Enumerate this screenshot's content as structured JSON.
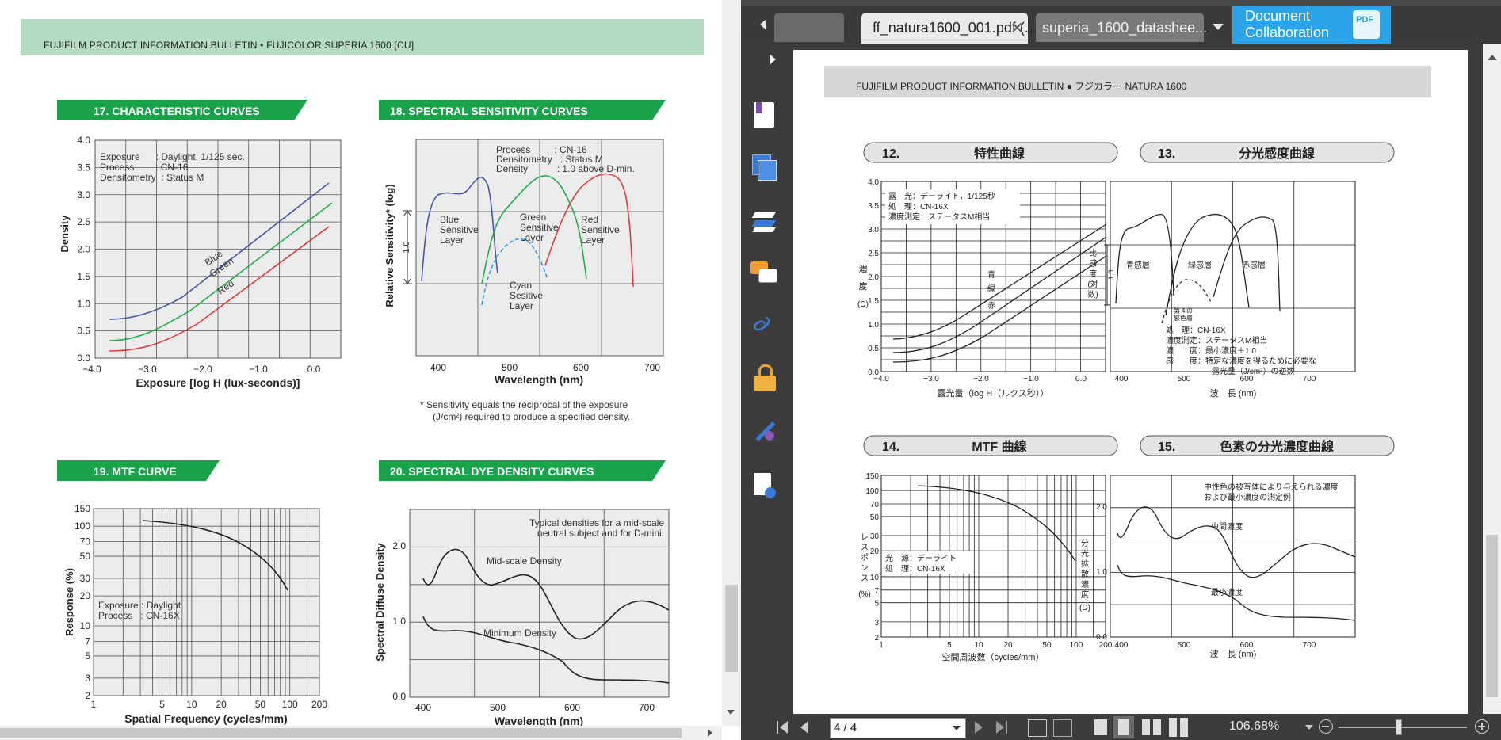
{
  "left_doc": {
    "header": "FUJIFILM PRODUCT INFORMATION BULLETIN • FUJICOLOR SUPERIA 1600 [CU]",
    "sec17": {
      "title": "17. CHARACTERISTIC CURVES",
      "notes": [
        "Exposure      : Daylight, 1/125 sec.",
        "Process        : CN-16",
        "Densitometry  : Status M"
      ],
      "xlabel": "Exposure [log H (lux-seconds)]",
      "ylabel": "Density",
      "xticks": [
        "−4.0",
        "−3.0",
        "−2.0",
        "−1.0",
        "0.0"
      ],
      "yticks": [
        "0.0",
        "0.5",
        "1.0",
        "1.5",
        "2.0",
        "2.5",
        "3.0",
        "3.5",
        "4.0"
      ],
      "curve_labels": [
        "Blue",
        "Green",
        "Red"
      ]
    },
    "sec18": {
      "title": "18. SPECTRAL SENSITIVITY CURVES",
      "notes": [
        "Process         : CN-16",
        "Densitometry   : Status M",
        "Density           : 1.0 above D-min."
      ],
      "xlabel": "Wavelength (nm)",
      "ylabel": "Relative Sensitivity* (log)",
      "xticks": [
        "400",
        "500",
        "600",
        "700"
      ],
      "scale_label": "1.0",
      "layers": [
        "Blue Sensitive Layer",
        "Green Sensitive Layer",
        "Red Sensitive Layer",
        "Cyan Sesitive Layer"
      ],
      "footnote_1": "*  Sensitivity equals the reciprocal of the exposure",
      "footnote_2": "(J/cm²) required to produce a specified density."
    },
    "sec19": {
      "title": "19. MTF CURVE",
      "xlabel": "Spatial Frequency (cycles/mm)",
      "ylabel": "Response (%)",
      "xticks": [
        "1",
        "5",
        "10",
        "20",
        "50",
        "100",
        "200"
      ],
      "yticks": [
        "150",
        "100",
        "70",
        "50",
        "30",
        "20",
        "10",
        "7",
        "5",
        "3",
        "2"
      ],
      "notes": [
        "Exposure : Daylight",
        "Process   : CN-16X"
      ]
    },
    "sec20": {
      "title": "20. SPECTRAL DYE DENSITY CURVES",
      "notes": [
        "Typical densities for a mid-scale",
        "neutral subject and for D-mini."
      ],
      "xlabel": "Wavelength (nm)",
      "ylabel": "Spectral Diffuse Density",
      "xticks": [
        "400",
        "500",
        "600",
        "700"
      ],
      "yticks": [
        "0.0",
        "1.0",
        "2.0"
      ],
      "curve_labels": [
        "Mid-scale Density",
        "Minimum Density"
      ]
    }
  },
  "right_viewer": {
    "tabs": [
      "ff_natura1600_001.pdf (...",
      "superia_1600_datashee..."
    ],
    "doc_collab": [
      "Document",
      "Collaboration"
    ],
    "pdf_badge": "PDF",
    "header": "FUJIFILM PRODUCT INFORMATION BULLETIN ● フジカラー NATURA 1600",
    "sec12": {
      "num": "12.",
      "title": "特性曲線",
      "notes": [
        "露　光：デーライト，1/125秒",
        "処　理：CN-16X",
        "濃度測定：ステータスM相当"
      ],
      "xlabel": "露光量（log H（ルクス秒））",
      "ylabel": [
        "濃",
        "度",
        "(D)"
      ],
      "xticks": [
        "−4.0",
        "−3.0",
        "−2.0",
        "−1.0",
        "0.0"
      ],
      "yticks": [
        "0.0",
        "0.5",
        "1.0",
        "1.5",
        "2.0",
        "2.5",
        "3.0",
        "3.5",
        "4.0"
      ],
      "curve_labels": [
        "青",
        "緑",
        "赤"
      ]
    },
    "sec13": {
      "num": "13.",
      "title": "分光感度曲線",
      "layers": [
        "青感層",
        "緑感層",
        "赤感層"
      ],
      "extra_layer": [
        "第４の",
        "感色層"
      ],
      "notes": [
        "処　理：CN-16X",
        "濃度測定：ステータスM相当",
        "濃　　度：最小濃度＋1.0",
        "感　　度：特定な濃度を得るために必要な",
        "露光量（J/cm²）の逆数"
      ],
      "xlabel": "波　長 (nm)",
      "ylabel": [
        "比",
        "感",
        "度",
        "(対",
        "数)"
      ],
      "scale_label": "1.0",
      "xticks": [
        "400",
        "500",
        "600",
        "700"
      ]
    },
    "sec14": {
      "num": "14.",
      "title": "MTF 曲線",
      "notes": [
        "光　源：デーライト",
        "処　理：CN-16X"
      ],
      "xlabel": "空間周波数（cycles/mm）",
      "ylabel": [
        "レ",
        "ス",
        "ポ",
        "ン",
        "ス",
        "(%)"
      ],
      "xticks": [
        "1",
        "5",
        "10",
        "20",
        "50",
        "100",
        "200"
      ],
      "yticks": [
        "150",
        "100",
        "70",
        "50",
        "30",
        "20",
        "10",
        "7",
        "5",
        "3",
        "2"
      ]
    },
    "sec15": {
      "num": "15.",
      "title": "色素の分光濃度曲線",
      "notes": [
        "中性色の被写体により与えられる濃度",
        "および最小濃度の測定例"
      ],
      "curve_labels": [
        "中間濃度",
        "最小濃度"
      ],
      "xlabel": "波　長 (nm)",
      "ylabel": [
        "分",
        "光",
        "拡",
        "散",
        "濃",
        "度",
        "(D)"
      ],
      "xticks": [
        "400",
        "500",
        "600",
        "700"
      ],
      "yticks": [
        "0.0",
        "1.0",
        "2.0"
      ]
    },
    "statusbar": {
      "page_value": "4 / 4",
      "zoom": "106.68%"
    }
  },
  "colors": {
    "green_banner": "#1aa34a",
    "header_green": "#b2dbc2",
    "blue_curve": "#4a56a6",
    "green_curve": "#1fae4a",
    "red_curve": "#e0393a",
    "cyan_curve": "#2e9ee0",
    "viewer_dark": "#2f2f2f",
    "collab_blue": "#2aa3e8"
  }
}
